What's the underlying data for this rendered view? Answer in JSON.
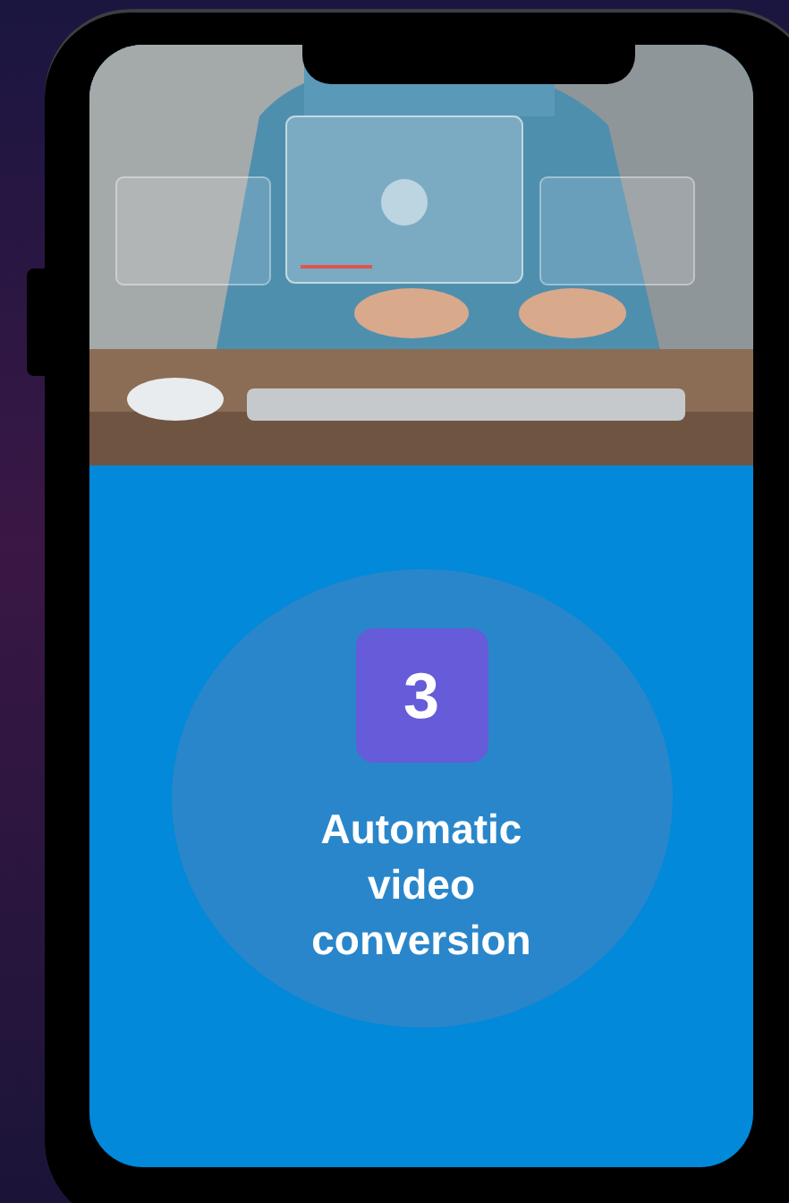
{
  "screen": {
    "step": {
      "number": "3",
      "label": "Automatic video conversion"
    }
  }
}
